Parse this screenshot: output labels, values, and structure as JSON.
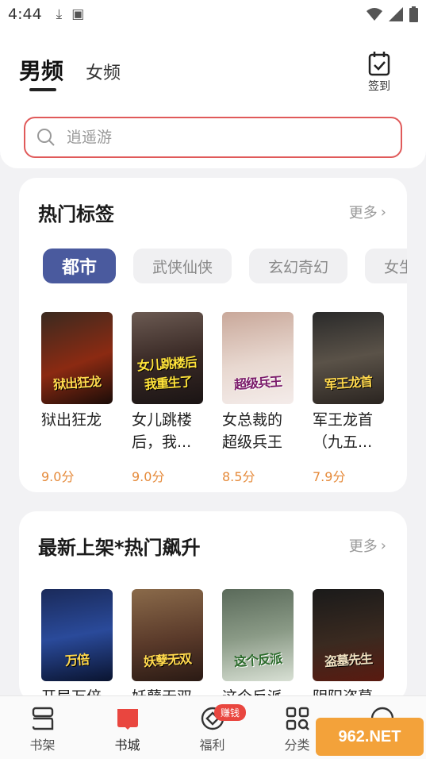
{
  "status_bar": {
    "time": "4:44"
  },
  "header": {
    "tab_male": "男频",
    "tab_female": "女频",
    "checkin_label": "签到",
    "search_placeholder": "逍遥游"
  },
  "hot_tags": {
    "title": "热门标签",
    "more": "更多",
    "tags": [
      "都市",
      "武侠仙侠",
      "玄幻奇幻",
      "女生"
    ],
    "books": [
      {
        "title": "狱出狂龙",
        "score": "9.0分",
        "cover_text": "狱出狂龙"
      },
      {
        "title": "女儿跳楼后，我...",
        "score": "9.0分",
        "cover_text": "女儿跳楼后我重生了"
      },
      {
        "title": "女总裁的超级兵王",
        "score": "8.5分",
        "cover_text": "超级兵王"
      },
      {
        "title": "军王龙首（九五...",
        "score": "7.9分",
        "cover_text": "军王龙首"
      }
    ]
  },
  "new_shelf": {
    "title": "最新上架*热门飙升",
    "more": "更多",
    "books": [
      {
        "title": "开局万倍",
        "cover_text": "万倍"
      },
      {
        "title": "妖孽无双",
        "cover_text": "妖孽无双"
      },
      {
        "title": "这个反派",
        "cover_text": "这个反派"
      },
      {
        "title": "阴阳盗墓",
        "cover_text": "盗墓先生"
      }
    ]
  },
  "bottom_nav": {
    "items": [
      "书架",
      "书城",
      "福利",
      "分类",
      "我的"
    ],
    "badge": "赚钱"
  },
  "watermark": "962.NET",
  "colors": {
    "accent": "#e05a5a",
    "tag_active": "#4a5a9e",
    "score": "#e58a3a",
    "badge": "#e9463f"
  }
}
